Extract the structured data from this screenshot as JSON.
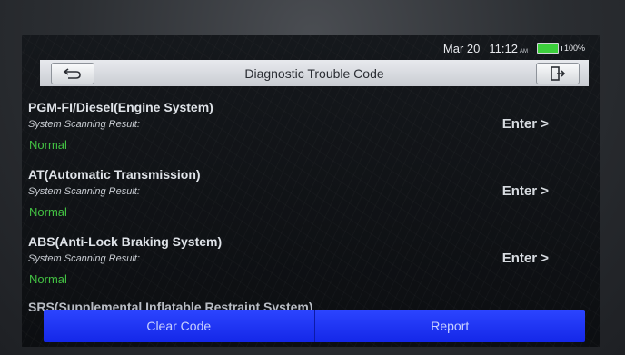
{
  "status_bar": {
    "date": "Mar 20",
    "time": "11:12",
    "ampm": "AM",
    "battery_percent": "100%",
    "battery_color": "#3ccf3c"
  },
  "header": {
    "title": "Diagnostic Trouble Code",
    "back_icon": "back-arrow-icon",
    "exit_icon": "exit-icon"
  },
  "systems": [
    {
      "name": "PGM-FI/Diesel(Engine System)",
      "result_label": "System Scanning Result:",
      "status": "Normal",
      "action": "Enter >"
    },
    {
      "name": "AT(Automatic Transmission)",
      "result_label": "System Scanning Result:",
      "status": "Normal",
      "action": "Enter >"
    },
    {
      "name": "ABS(Anti-Lock Braking System)",
      "result_label": "System Scanning Result:",
      "status": "Normal",
      "action": "Enter >"
    },
    {
      "name": "SRS(Supplemental Inflatable Restraint System)"
    }
  ],
  "footer": {
    "clear_code_label": "Clear Code",
    "report_label": "Report",
    "accent_color": "#1f35f5"
  },
  "colors": {
    "status_normal": "#43c143"
  }
}
